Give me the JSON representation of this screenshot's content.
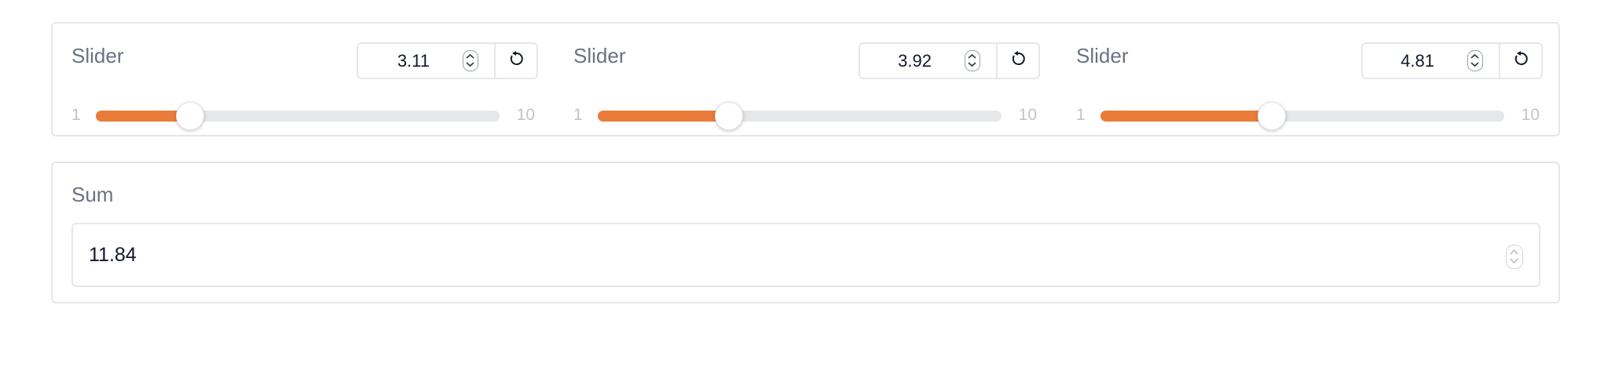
{
  "sliders": [
    {
      "label": "Slider",
      "value": "3.11",
      "min": "1",
      "max": "10",
      "fraction": 0.2344
    },
    {
      "label": "Slider",
      "value": "3.92",
      "min": "1",
      "max": "10",
      "fraction": 0.3244
    },
    {
      "label": "Slider",
      "value": "4.81",
      "min": "1",
      "max": "10",
      "fraction": 0.4233
    }
  ],
  "sum": {
    "label": "Sum",
    "value": "11.84"
  },
  "colors": {
    "accent": "#ea7c39",
    "track": "#e5e7eb",
    "border": "#e5e7eb",
    "label": "#6b7280"
  },
  "icons": {
    "spinner": "spinner-arrows-icon",
    "reset": "reset-icon"
  }
}
